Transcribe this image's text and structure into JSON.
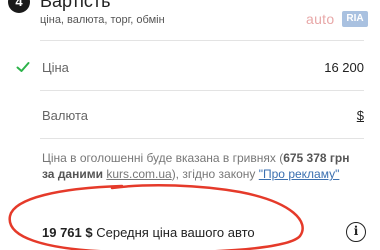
{
  "step": {
    "number": "4",
    "title": "Вартість",
    "subtitle": "ціна, валюта, торг, обмін"
  },
  "logo": {
    "auto": "auto",
    "ria": "RIA"
  },
  "price": {
    "label": "Ціна",
    "value": "16 200",
    "check_icon": "checkmark-icon",
    "check_color": "#2db34a"
  },
  "currency": {
    "label": "Валюта",
    "value": "$"
  },
  "note": {
    "text_before": "Ціна в оголошенні буде вказана в гривнях (",
    "uah_amount": "675 378 грн за даними",
    "site": "kurs.com.ua",
    "text_after": "), згідно закону",
    "link": "\"Про рекламу\""
  },
  "average": {
    "value": "19 761 $",
    "label": "Середня ціна вашого авто",
    "info_icon": "info-icon"
  },
  "annotation": {
    "color": "#e53a2a"
  }
}
